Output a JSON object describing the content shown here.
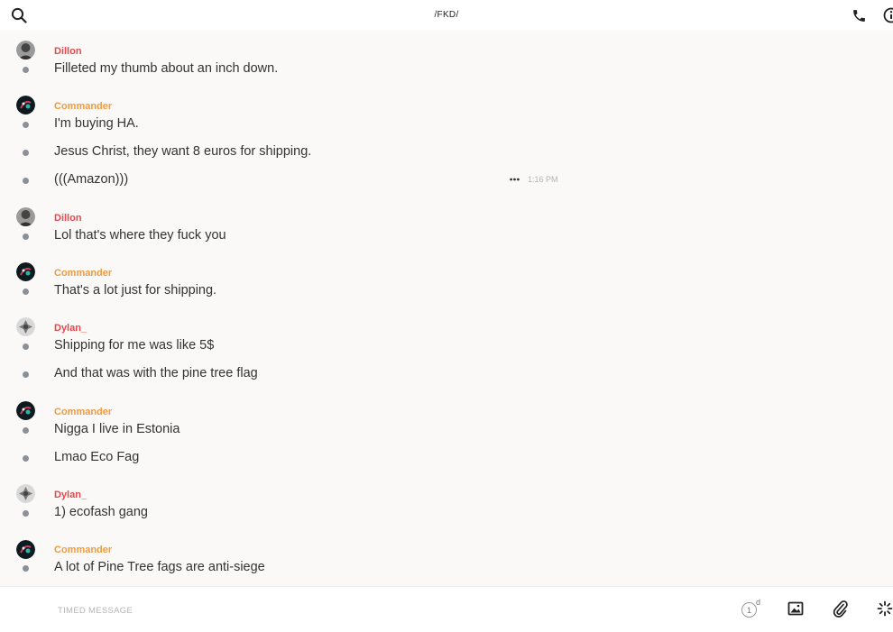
{
  "header": {
    "title": "/FKD/"
  },
  "messages": [
    {
      "author": "Dillon",
      "author_color": "#e5484d",
      "avatar": "dillon-avatar",
      "text": "Filleted my thumb about an inch down."
    },
    {
      "author": "Commander",
      "author_color": "#f19a3e",
      "avatar": "commander-avatar",
      "text": "I'm buying HA."
    },
    {
      "text": "Jesus Christ, they want 8 euros for shipping."
    },
    {
      "text": "(((Amazon)))",
      "timestamp": "1:16 PM"
    },
    {
      "author": "Dillon",
      "author_color": "#e5484d",
      "avatar": "dillon-avatar",
      "text": "Lol that's where they fuck you"
    },
    {
      "author": "Commander",
      "author_color": "#f19a3e",
      "avatar": "commander-avatar",
      "text": "That's a lot just for shipping."
    },
    {
      "author": "Dylan_",
      "author_color": "#e5484d",
      "avatar": "dylan-avatar",
      "text": "Shipping for me was like 5$"
    },
    {
      "text": "And that was with the pine tree flag"
    },
    {
      "author": "Commander",
      "author_color": "#f19a3e",
      "avatar": "commander-avatar",
      "text": "Nigga I live in Estonia"
    },
    {
      "text": "Lmao Eco Fag"
    },
    {
      "author": "Dylan_",
      "author_color": "#e5484d",
      "avatar": "dylan-avatar",
      "text": "1) ecofash gang"
    },
    {
      "author": "Commander",
      "author_color": "#f19a3e",
      "avatar": "commander-avatar",
      "text": "A lot of Pine Tree fags are anti-siege"
    }
  ],
  "composer": {
    "placeholder": "TIMED MESSAGE",
    "timer_count": "1",
    "timer_unit": "d"
  },
  "icons": {
    "search": "search-icon",
    "call": "phone-icon",
    "info": "info-icon",
    "more": "more-options-icon",
    "image": "image-icon",
    "attach": "paperclip-icon",
    "gif": "sparkle-icon"
  },
  "colors": {
    "dillon": "#e5484d",
    "commander": "#f19a3e",
    "dylan": "#e5484d",
    "bullet": "#8a9096",
    "background": "#faf9f8"
  }
}
